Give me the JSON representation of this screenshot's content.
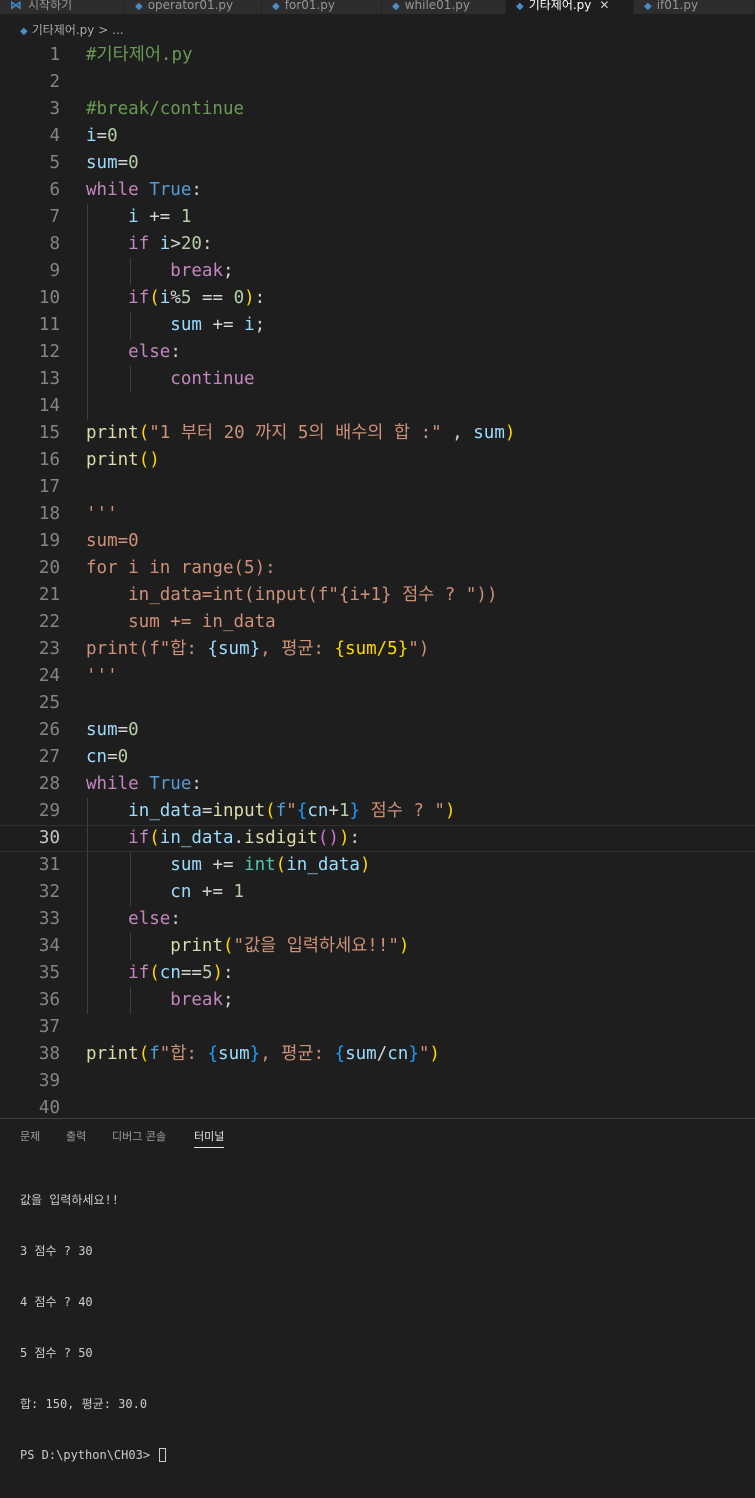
{
  "tabs": [
    {
      "label": "시작하기",
      "icon": "vscode-logo-icon",
      "active": false
    },
    {
      "label": "operator01.py",
      "icon": "python-file-icon",
      "active": false
    },
    {
      "label": "for01.py",
      "icon": "python-file-icon",
      "active": false
    },
    {
      "label": "while01.py",
      "icon": "python-file-icon",
      "active": false
    },
    {
      "label": "기타제어.py",
      "icon": "python-file-icon",
      "active": true
    },
    {
      "label": "if01.py",
      "icon": "python-file-icon",
      "active": false
    }
  ],
  "breadcrumb": {
    "file": "기타제어.py",
    "sep": ">",
    "rest": "..."
  },
  "editor": {
    "current_line": 30,
    "lines": [
      [
        [
          "cmt",
          "#기타제어.py"
        ]
      ],
      [],
      [
        [
          "cmt",
          "#break/continue"
        ]
      ],
      [
        [
          "var",
          "i"
        ],
        [
          "op",
          "="
        ],
        [
          "num",
          "0"
        ]
      ],
      [
        [
          "var",
          "sum"
        ],
        [
          "op",
          "="
        ],
        [
          "num",
          "0"
        ]
      ],
      [
        [
          "kw",
          "while"
        ],
        [
          "op",
          " "
        ],
        [
          "bool",
          "True"
        ],
        [
          "op",
          ":"
        ]
      ],
      [
        [
          "op",
          "    "
        ],
        [
          "var",
          "i"
        ],
        [
          "op",
          " += "
        ],
        [
          "num",
          "1"
        ]
      ],
      [
        [
          "op",
          "    "
        ],
        [
          "kw",
          "if"
        ],
        [
          "op",
          " "
        ],
        [
          "var",
          "i"
        ],
        [
          "op",
          ">"
        ],
        [
          "num",
          "20"
        ],
        [
          "op",
          ":"
        ]
      ],
      [
        [
          "op",
          "        "
        ],
        [
          "kw",
          "break"
        ],
        [
          "op",
          ";"
        ]
      ],
      [
        [
          "op",
          "    "
        ],
        [
          "kw",
          "if"
        ],
        [
          "br1",
          "("
        ],
        [
          "var",
          "i"
        ],
        [
          "op",
          "%"
        ],
        [
          "num",
          "5"
        ],
        [
          "op",
          " == "
        ],
        [
          "num",
          "0"
        ],
        [
          "br1",
          ")"
        ],
        [
          "op",
          ":"
        ]
      ],
      [
        [
          "op",
          "        "
        ],
        [
          "var",
          "sum"
        ],
        [
          "op",
          " += "
        ],
        [
          "var",
          "i"
        ],
        [
          "op",
          ";"
        ]
      ],
      [
        [
          "op",
          "    "
        ],
        [
          "kw",
          "else"
        ],
        [
          "op",
          ":"
        ]
      ],
      [
        [
          "op",
          "        "
        ],
        [
          "kw",
          "continue"
        ]
      ],
      [],
      [
        [
          "fn",
          "print"
        ],
        [
          "br1",
          "("
        ],
        [
          "str",
          "\"1 부터 20 까지 5의 배수의 합 :\""
        ],
        [
          "op",
          " , "
        ],
        [
          "var",
          "sum"
        ],
        [
          "br1",
          ")"
        ]
      ],
      [
        [
          "fn",
          "print"
        ],
        [
          "br1",
          "()"
        ]
      ],
      [],
      [
        [
          "str",
          "'''"
        ]
      ],
      [
        [
          "str",
          "sum=0"
        ]
      ],
      [
        [
          "str",
          "for i in range(5):"
        ]
      ],
      [
        [
          "str",
          "    in_data=int(input(f\"{i+1} 점수 ? \"))"
        ]
      ],
      [
        [
          "str",
          "    sum += in_data"
        ]
      ],
      [
        [
          "str",
          "print(f\"합: "
        ],
        [
          "var",
          "{sum}"
        ],
        [
          "str",
          ", 평균: "
        ],
        [
          "br1",
          "{sum/5}"
        ],
        [
          "str",
          "\")"
        ]
      ],
      [
        [
          "str",
          "'''"
        ]
      ],
      [],
      [
        [
          "var",
          "sum"
        ],
        [
          "op",
          "="
        ],
        [
          "num",
          "0"
        ]
      ],
      [
        [
          "var",
          "cn"
        ],
        [
          "op",
          "="
        ],
        [
          "num",
          "0"
        ]
      ],
      [
        [
          "kw",
          "while"
        ],
        [
          "op",
          " "
        ],
        [
          "bool",
          "True"
        ],
        [
          "op",
          ":"
        ]
      ],
      [
        [
          "op",
          "    "
        ],
        [
          "var",
          "in_data"
        ],
        [
          "op",
          "="
        ],
        [
          "fn",
          "input"
        ],
        [
          "br1",
          "("
        ],
        [
          "bool",
          "f"
        ],
        [
          "str",
          "\""
        ],
        [
          "br3",
          "{"
        ],
        [
          "var",
          "cn"
        ],
        [
          "op",
          "+"
        ],
        [
          "num",
          "1"
        ],
        [
          "br3",
          "}"
        ],
        [
          "str",
          " 점수 ? \""
        ],
        [
          "br1",
          ")"
        ]
      ],
      [
        [
          "op",
          "    "
        ],
        [
          "kw",
          "if"
        ],
        [
          "br1",
          "("
        ],
        [
          "var",
          "in_data"
        ],
        [
          "op",
          "."
        ],
        [
          "fn",
          "isdigit"
        ],
        [
          "br2",
          "()"
        ],
        [
          "br1",
          ")"
        ],
        [
          "op",
          ":"
        ]
      ],
      [
        [
          "op",
          "        "
        ],
        [
          "var",
          "sum"
        ],
        [
          "op",
          " += "
        ],
        [
          "cls",
          "int"
        ],
        [
          "br1",
          "("
        ],
        [
          "var",
          "in_data"
        ],
        [
          "br1",
          ")"
        ]
      ],
      [
        [
          "op",
          "        "
        ],
        [
          "var",
          "cn"
        ],
        [
          "op",
          " += "
        ],
        [
          "num",
          "1"
        ]
      ],
      [
        [
          "op",
          "    "
        ],
        [
          "kw",
          "else"
        ],
        [
          "op",
          ":"
        ]
      ],
      [
        [
          "op",
          "        "
        ],
        [
          "fn",
          "print"
        ],
        [
          "br1",
          "("
        ],
        [
          "str",
          "\"값을 입력하세요!!\""
        ],
        [
          "br1",
          ")"
        ]
      ],
      [
        [
          "op",
          "    "
        ],
        [
          "kw",
          "if"
        ],
        [
          "br1",
          "("
        ],
        [
          "var",
          "cn"
        ],
        [
          "op",
          "=="
        ],
        [
          "num",
          "5"
        ],
        [
          "br1",
          ")"
        ],
        [
          "op",
          ":"
        ]
      ],
      [
        [
          "op",
          "        "
        ],
        [
          "kw",
          "break"
        ],
        [
          "op",
          ";"
        ]
      ],
      [],
      [
        [
          "fn",
          "print"
        ],
        [
          "br1",
          "("
        ],
        [
          "bool",
          "f"
        ],
        [
          "str",
          "\"합: "
        ],
        [
          "br3",
          "{"
        ],
        [
          "var",
          "sum"
        ],
        [
          "br3",
          "}"
        ],
        [
          "str",
          ", 평균: "
        ],
        [
          "br3",
          "{"
        ],
        [
          "var",
          "sum"
        ],
        [
          "op",
          "/"
        ],
        [
          "var",
          "cn"
        ],
        [
          "br3",
          "}"
        ],
        [
          "str",
          "\""
        ],
        [
          "br1",
          ")"
        ]
      ],
      [],
      []
    ]
  },
  "panel": {
    "tabs": [
      {
        "label": "문제",
        "active": false
      },
      {
        "label": "출력",
        "active": false
      },
      {
        "label": "디버그 콘솔",
        "active": false
      },
      {
        "label": "터미널",
        "active": true
      }
    ],
    "terminal_lines": [
      "값을 입력하세요!!",
      "3 점수 ? 30",
      "4 점수 ? 40",
      "5 점수 ? 50",
      "합: 150, 평균: 30.0"
    ],
    "prompt": "PS D:\\python\\CH03>"
  }
}
